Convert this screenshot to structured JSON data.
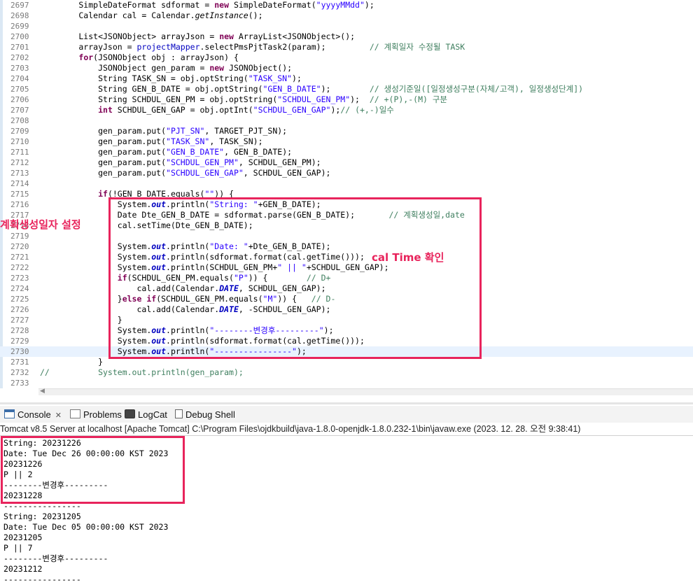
{
  "editor": {
    "lines": [
      {
        "n": "2697",
        "t": "        SimpleDateFormat sdformat = new SimpleDateFormat(\"yyyyMMdd\");"
      },
      {
        "n": "2698",
        "t": "        Calendar cal = Calendar.getInstance();"
      },
      {
        "n": "2699",
        "t": ""
      },
      {
        "n": "2700",
        "t": "        List<JSONObject> arrayJson = new ArrayList<JSONObject>();"
      },
      {
        "n": "2701",
        "t": "        arrayJson = projectMapper.selectPmsPjtTask2(param);         // 계획일자 수정될 TASK"
      },
      {
        "n": "2702",
        "t": "        for(JSONObject obj : arrayJson) {"
      },
      {
        "n": "2703",
        "t": "            JSONObject gen_param = new JSONObject();"
      },
      {
        "n": "2704",
        "t": "            String TASK_SN = obj.optString(\"TASK_SN\");"
      },
      {
        "n": "2705",
        "t": "            String GEN_B_DATE = obj.optString(\"GEN_B_DATE\");        // 생성기준일([일정생성구분(자체/고객), 일정생성단계])"
      },
      {
        "n": "2706",
        "t": "            String SCHDUL_GEN_PM = obj.optString(\"SCHDUL_GEN_PM\");  // +(P),-(M) 구분"
      },
      {
        "n": "2707",
        "t": "            int SCHDUL_GEN_GAP = obj.optInt(\"SCHDUL_GEN_GAP\");// (+,-)일수"
      },
      {
        "n": "2708",
        "t": ""
      },
      {
        "n": "2709",
        "t": "            gen_param.put(\"PJT_SN\", TARGET_PJT_SN);"
      },
      {
        "n": "2710",
        "t": "            gen_param.put(\"TASK_SN\", TASK_SN);"
      },
      {
        "n": "2711",
        "t": "            gen_param.put(\"GEN_B_DATE\", GEN_B_DATE);"
      },
      {
        "n": "2712",
        "t": "            gen_param.put(\"SCHDUL_GEN_PM\", SCHDUL_GEN_PM);"
      },
      {
        "n": "2713",
        "t": "            gen_param.put(\"SCHDUL_GEN_GAP\", SCHDUL_GEN_GAP);"
      },
      {
        "n": "2714",
        "t": ""
      },
      {
        "n": "2715",
        "t": "            if(!GEN_B_DATE.equals(\"\")) {"
      },
      {
        "n": "2716",
        "t": "                System.out.println(\"String: \"+GEN_B_DATE);"
      },
      {
        "n": "2717",
        "t": "                Date Dte_GEN_B_DATE = sdformat.parse(GEN_B_DATE);       // 계획생성일,date"
      },
      {
        "n": "2718",
        "t": "                cal.setTime(Dte_GEN_B_DATE);"
      },
      {
        "n": "2719",
        "t": ""
      },
      {
        "n": "2720",
        "t": "                System.out.println(\"Date: \"+Dte_GEN_B_DATE);"
      },
      {
        "n": "2721",
        "t": "                System.out.println(sdformat.format(cal.getTime()));"
      },
      {
        "n": "2722",
        "t": "                System.out.println(SCHDUL_GEN_PM+\" || \"+SCHDUL_GEN_GAP);"
      },
      {
        "n": "2723",
        "t": "                if(SCHDUL_GEN_PM.equals(\"P\")) {        // D+"
      },
      {
        "n": "2724",
        "t": "                    cal.add(Calendar.DATE, SCHDUL_GEN_GAP);"
      },
      {
        "n": "2725",
        "t": "                }else if(SCHDUL_GEN_PM.equals(\"M\")) {   // D-"
      },
      {
        "n": "2726",
        "t": "                    cal.add(Calendar.DATE, -SCHDUL_GEN_GAP);"
      },
      {
        "n": "2727",
        "t": "                }"
      },
      {
        "n": "2728",
        "t": "                System.out.println(\"--------변경후---------\");"
      },
      {
        "n": "2729",
        "t": "                System.out.println(sdformat.format(cal.getTime()));"
      },
      {
        "n": "2730",
        "t": "                System.out.println(\"----------------\");"
      },
      {
        "n": "2731",
        "t": "            }"
      },
      {
        "n": "2732",
        "t": "//          System.out.println(gen_param);"
      },
      {
        "n": "2733",
        "t": ""
      }
    ]
  },
  "annotations": {
    "left_label": "계획생성일자 설정",
    "right_label": "cal Time 확인"
  },
  "tabs": [
    {
      "label": "Console",
      "icon": "console-icon",
      "active": true
    },
    {
      "label": "Problems",
      "icon": "problems-icon"
    },
    {
      "label": "LogCat",
      "icon": "logcat-icon"
    },
    {
      "label": "Debug Shell",
      "icon": "debug-shell-icon"
    }
  ],
  "console": {
    "server_line": "Tomcat v8.5 Server at localhost [Apache Tomcat] C:\\Program Files\\ojdkbuild\\java-1.8.0-openjdk-1.8.0.232-1\\bin\\javaw.exe (2023. 12. 28. 오전 9:38:41)",
    "lines": [
      "String: 20231226",
      "Date: Tue Dec 26 00:00:00 KST 2023",
      "20231226",
      "P || 2",
      "--------변경후---------",
      "20231228",
      "----------------",
      "String: 20231205",
      "Date: Tue Dec 05 00:00:00 KST 2023",
      "20231205",
      "P || 7",
      "--------변경후---------",
      "20231212",
      "----------------"
    ]
  },
  "colors": {
    "highlight_box": "#e8245c",
    "keyword": "#7f0055",
    "string": "#2a00ff",
    "comment": "#3f7f5f"
  }
}
